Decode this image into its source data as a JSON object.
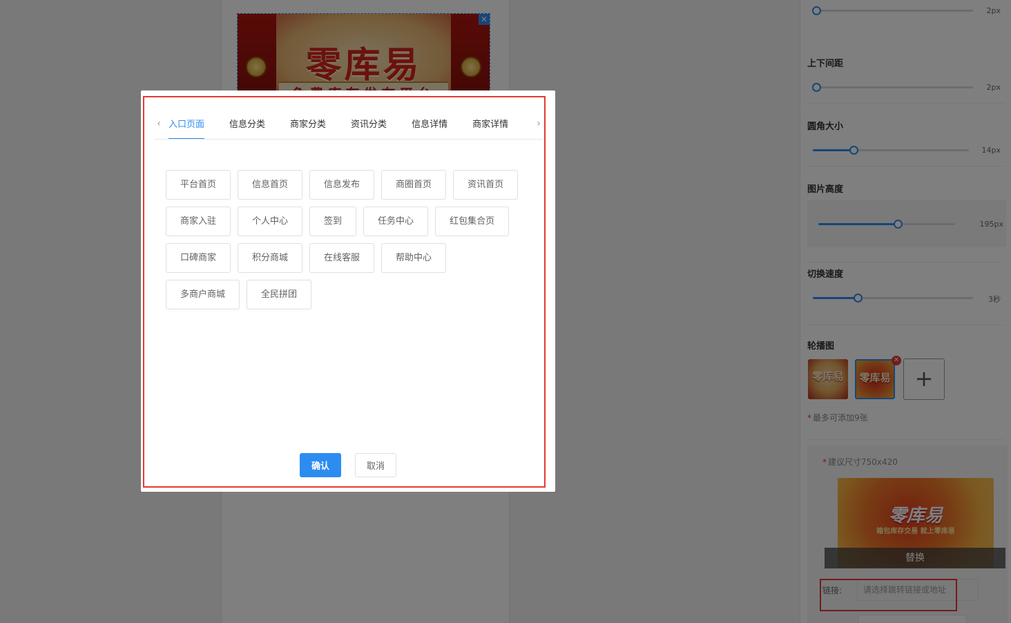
{
  "preview": {
    "banner_title": "零库易",
    "banner_subtitle": "免费库存发布平台",
    "close_glyph": "✕"
  },
  "settings": {
    "sliders": [
      {
        "label": "",
        "value_text": "2px",
        "fraction": 0.02
      },
      {
        "label": "上下间距",
        "value_text": "2px",
        "fraction": 0.02
      },
      {
        "label": "圆角大小",
        "value_text": "14px",
        "fraction": 0.26
      },
      {
        "label": "图片高度",
        "value_text": "195px",
        "fraction": 0.58
      },
      {
        "label": "切换速度",
        "value_text": "3秒",
        "fraction": 0.28
      }
    ],
    "carousel": {
      "label": "轮播图",
      "thumb1_text": "零库易",
      "thumb2_text": "零库易",
      "remove_glyph": "✕",
      "add_glyph": "+",
      "max_note": "最多可添加9张"
    },
    "item": {
      "required_mark": "*",
      "size_note": "建议尺寸750x420",
      "image_title": "零库易",
      "image_slogan": "箱包库存交易 就上零库易",
      "replace_label": "替换",
      "link_label": "链接:",
      "link_placeholder": "请选择跳转链接或地址"
    }
  },
  "modal": {
    "prev_arrow": "‹",
    "next_arrow": "›",
    "tabs": [
      "入口页面",
      "信息分类",
      "商家分类",
      "资讯分类",
      "信息详情",
      "商家详情"
    ],
    "active_tab": 0,
    "page_rows": [
      [
        "平台首页",
        "信息首页",
        "信息发布",
        "商圈首页",
        "资讯首页"
      ],
      [
        "商家入驻",
        "个人中心",
        "签到",
        "任务中心",
        "红包集合页"
      ],
      [
        "口碑商家",
        "积分商城",
        "在线客服",
        "帮助中心"
      ],
      [
        "多商户商城",
        "全民拼团"
      ]
    ],
    "confirm_label": "确认",
    "cancel_label": "取消"
  },
  "colors": {
    "accent": "#2d8cf0",
    "highlight": "#e53935",
    "overlay": "rgba(0,0,0,0.5)"
  }
}
